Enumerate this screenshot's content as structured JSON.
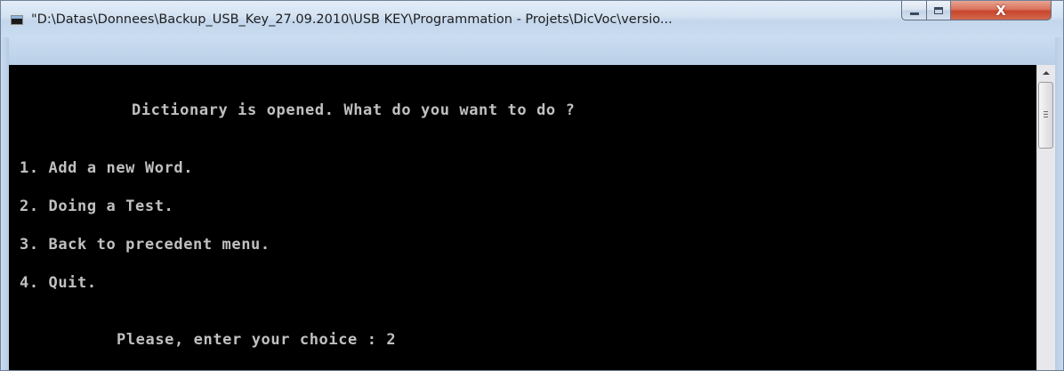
{
  "window": {
    "title": "\"D:\\Datas\\Donnees\\Backup_USB_Key_27.09.2010\\USB KEY\\Programmation - Projets\\DicVoc\\versio...",
    "icon": "console-icon",
    "controls": {
      "minimize_icon": "minimize-icon",
      "maximize_icon": "maximize-icon",
      "close_icon": "close-icon",
      "close_label": "X"
    }
  },
  "console": {
    "background": "#000000",
    "foreground": "#c0c0c0",
    "header": "Dictionary is opened. What do you want to do ?",
    "options": [
      "1. Add a new Word.",
      "2. Doing a Test.",
      "3. Back to precedent menu.",
      "4. Quit."
    ],
    "prompt": "Please, enter your choice : 2"
  },
  "scrollbar": {
    "up_icon": "scroll-up-arrow-icon",
    "thumb_icon": "scroll-thumb-grip-icon"
  },
  "colors": {
    "close_button": "#c8452b",
    "titlebar": "#d2e1f1"
  }
}
